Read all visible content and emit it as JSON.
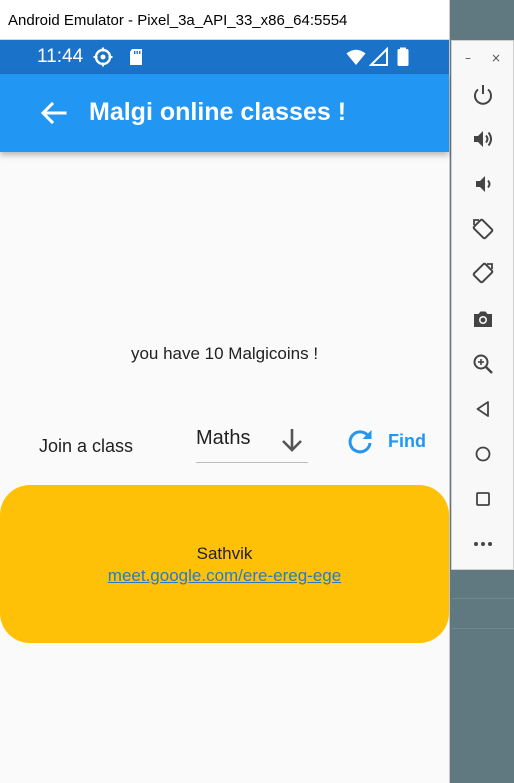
{
  "window": {
    "title": "Android Emulator - Pixel_3a_API_33_x86_64:5554"
  },
  "statusbar": {
    "time": "11:44"
  },
  "appbar": {
    "title": "Malgi online classes !"
  },
  "main": {
    "coins_text": "you have 10 Malgicoins !",
    "join_label": "Join a class",
    "subject_dropdown": {
      "selected": "Maths"
    },
    "find_label": "Find"
  },
  "class_card": {
    "name": "Sathvik",
    "link": "meet.google.com/ere-ereg-ege"
  },
  "toolbar": {
    "minimize": "–",
    "close": "×"
  },
  "colors": {
    "statusbar": "#1a73c9",
    "appbar": "#2196f3",
    "card": "#ffc107",
    "link": "#2a7bbf",
    "accent": "#2196f3"
  },
  "icons": {
    "back": "arrow-left-icon",
    "settings": "gear-icon",
    "sd": "sd-card-icon",
    "wifi": "wifi-icon",
    "signal": "signal-icon",
    "battery": "battery-icon",
    "dropdown": "arrow-down-icon",
    "refresh": "refresh-icon",
    "power": "power-icon",
    "volume_up": "volume-up-icon",
    "volume_down": "volume-down-icon",
    "rotate_left": "rotate-left-icon",
    "rotate_right": "rotate-right-icon",
    "camera": "camera-icon",
    "zoom": "zoom-icon",
    "back_nav": "back-triangle-icon",
    "home": "home-circle-icon",
    "overview": "overview-square-icon",
    "more": "more-dots-icon"
  }
}
